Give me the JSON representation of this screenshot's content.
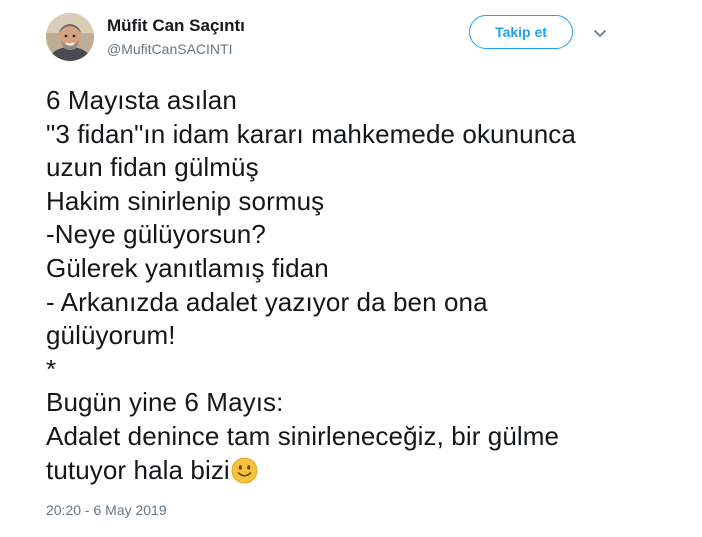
{
  "author": {
    "display_name": "Müfit Can Saçıntı",
    "handle": "@MufitCanSACINTI"
  },
  "follow_button_label": "Takip et",
  "icons": {
    "avatar": "avatar-photo",
    "more": "chevron-down-icon",
    "emoji": "slightly-smiling-face-icon"
  },
  "colors": {
    "accent": "#1da1f2",
    "text": "#14171a",
    "muted": "#657786",
    "emoji": "#f5c33b"
  },
  "tweet": {
    "lines": [
      "6 Mayısta asılan",
      "\"3 fidan\"ın idam kararı mahkemede okununca",
      "uzun fidan gülmüş",
      "Hakim sinirlenip sormuş",
      "-Neye gülüyorsun?",
      "Gülerek yanıtlamış fidan",
      "- Arkanızda adalet yazıyor da ben ona",
      "gülüyorum!",
      "*",
      "Bugün yine 6 Mayıs:",
      "Adalet denince tam sinirleneceğiz, bir gülme",
      "tutuyor hala bizi"
    ]
  },
  "timestamp": "20:20 - 6 May 2019"
}
